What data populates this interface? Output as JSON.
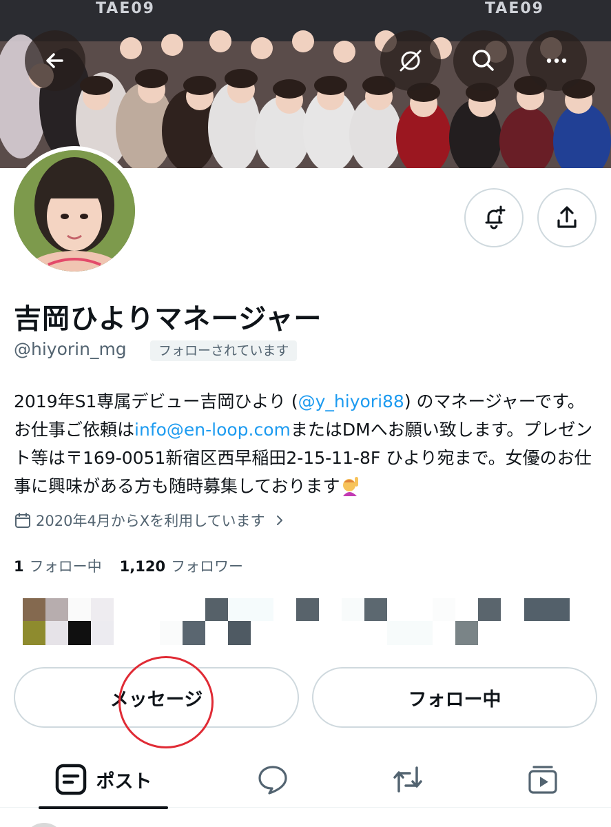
{
  "header": {
    "banner_sign_left": "TAE09",
    "banner_sign_right": "TAE09",
    "back_label": "",
    "translate_label": "",
    "search_label": "",
    "more_label": ""
  },
  "profile": {
    "display_name": "吉岡ひよりマネージャー",
    "handle": "@hiyorin_mg",
    "follows_you": "フォローされています",
    "bio": {
      "part1": "2019年S1専属デビュー吉岡ひより (",
      "mention": "@y_hiyori88",
      "part2": ") のマネージャーです。お仕事ご依頼は",
      "email": "info@en-loop.com",
      "part3": "またはDMへお願い致します。プレゼント等は〒169-0051新宿区西早稲田2-15-11-8F ひより宛まで。女優のお仕事に興味がある方も随時募集しております",
      "emoji": "raising-hand-emoji"
    },
    "joined": "2020年4月からXを利用しています",
    "following_count": "1",
    "following_label": "フォロー中",
    "followers_count": "1,120",
    "followers_label": "フォロワー"
  },
  "actions": {
    "message_label": "メッセージ",
    "following_label": "フォロー中"
  },
  "tabs": {
    "posts_label": "ポスト"
  },
  "colors": {
    "accent_link": "#1d9bf0",
    "text_primary": "#0f1419",
    "text_secondary": "#536471",
    "annotation_circle": "#e02b35"
  },
  "icons": [
    "back-arrow-icon",
    "translate-off-icon",
    "search-icon",
    "more-icon",
    "bell-plus-icon",
    "share-icon",
    "calendar-icon",
    "chevron-right-icon",
    "posts-icon",
    "reply-icon",
    "repost-icon",
    "media-icon"
  ]
}
